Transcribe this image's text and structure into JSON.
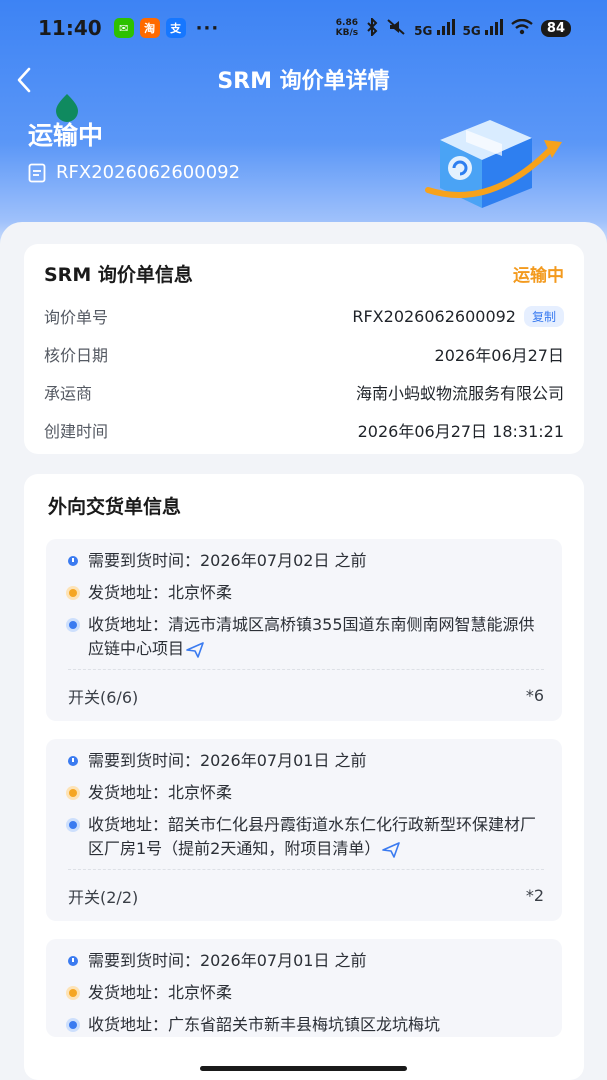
{
  "status_bar": {
    "time": "11:40",
    "apps": [
      {
        "icon": "wechat-icon",
        "color": "#2dc100",
        "glyph": "✉"
      },
      {
        "icon": "taobao-icon",
        "color": "#ff6a00",
        "glyph": "淘"
      },
      {
        "icon": "alipay-icon",
        "color": "#1677ff",
        "glyph": "支"
      }
    ],
    "more": "···",
    "net_speed_value": "6.86",
    "net_speed_unit": "KB/s",
    "signal_1": "5G",
    "signal_2": "5G",
    "battery": "84"
  },
  "header": {
    "title": "SRM 询价单详情",
    "status": "运输中",
    "doc_number": "RFX2026062600092"
  },
  "inquiry_info": {
    "title": "SRM 询价单信息",
    "status": "运输中",
    "status_color": "#f39a1e",
    "rows": [
      {
        "label": "询价单号",
        "value": "RFX2026062600092"
      },
      {
        "label": "核价日期",
        "value": "2026年06月27日"
      },
      {
        "label": "承运商",
        "value": "海南小蚂蚁物流服务有限公司"
      },
      {
        "label": "创建时间",
        "value": "2026年06月27日 18:31:21"
      }
    ],
    "copy_label": "复制"
  },
  "outbound": {
    "title": "外向交货单信息",
    "deliveries": [
      {
        "arrival": "需要到货时间：2026年07月02日 之前",
        "ship_from": "发货地址：北京怀柔",
        "ship_to": "收货地址：清远市清城区高桥镇355国道东南侧南网智慧能源供应链中心项目",
        "item": "开关(6/6)",
        "qty": "*6"
      },
      {
        "arrival": "需要到货时间：2026年07月01日 之前",
        "ship_from": "发货地址：北京怀柔",
        "ship_to": "收货地址：韶关市仁化县丹霞街道水东仁化行政新型环保建材厂区厂房1号（提前2天通知，附项目清单）",
        "item": "开关(2/2)",
        "qty": "*2"
      },
      {
        "arrival": "需要到货时间：2026年07月01日 之前",
        "ship_from": "发货地址：北京怀柔",
        "ship_to": "收货地址：广东省韶关市新丰县梅坑镇区龙坑梅坑",
        "item": "",
        "qty": ""
      }
    ]
  }
}
